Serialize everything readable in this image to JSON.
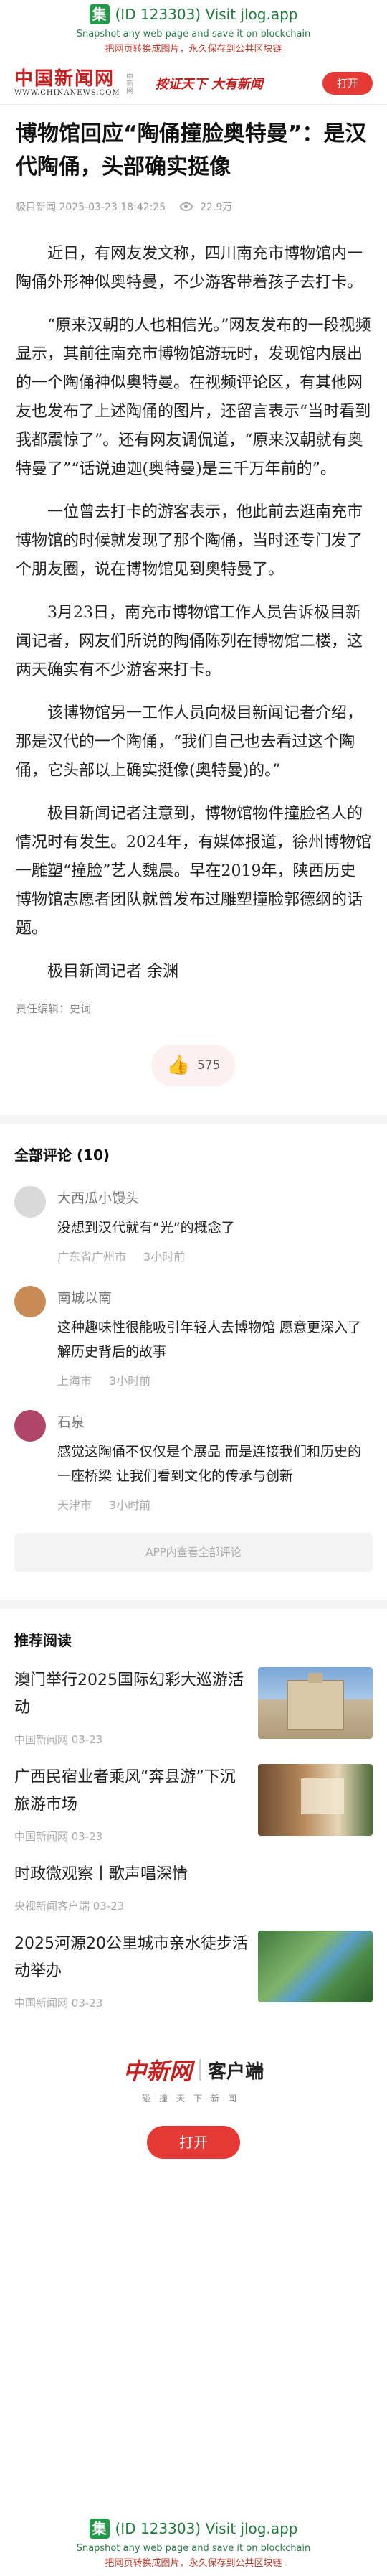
{
  "banner": {
    "logo_char": "集",
    "line1": "(ID 123303) Visit jlog.app",
    "line2": "Snapshot any web page and save it on blockchain",
    "line3": "把网页转换成图片，永久保存到公共区块链"
  },
  "header": {
    "brand_cn": "中国新闻网",
    "brand_en": "WWW.CHINANEWS.COM",
    "brand_sub": "中新网",
    "slogan": "按证天下 大有新闻",
    "open_label": "打开"
  },
  "article": {
    "title": "博物馆回应“陶俑撞脸奥特曼”：是汉代陶俑，头部确实挺像",
    "source": "极目新闻 2025-03-23 18:42:25",
    "views": "22.9万",
    "paragraphs": [
      "近日，有网友发文称，四川南充市博物馆内一陶俑外形神似奥特曼，不少游客带着孩子去打卡。",
      "“原来汉朝的人也相信光。”网友发布的一段视频显示，其前往南充市博物馆游玩时，发现馆内展出的一个陶俑神似奥特曼。在视频评论区，有其他网友也发布了上述陶俑的图片，还留言表示“当时看到我都震惊了”。还有网友调侃道，“原来汉朝就有奥特曼了”“话说迪迦(奥特曼)是三千万年前的”。",
      "一位曾去打卡的游客表示，他此前去逛南充市博物馆的时候就发现了那个陶俑，当时还专门发了个朋友圈，说在博物馆见到奥特曼了。",
      "3月23日，南充市博物馆工作人员告诉极目新闻记者，网友们所说的陶俑陈列在博物馆二楼，这两天确实有不少游客来打卡。",
      "该博物馆另一工作人员向极目新闻记者介绍，那是汉代的一个陶俑，“我们自己也去看过这个陶俑，它头部以上确实挺像(奥特曼)的。”",
      "极目新闻记者注意到，博物馆物件撞脸名人的情况时有发生。2024年，有媒体报道，徐州博物馆一雕塑“撞脸”艺人魏晨。早在2019年，陕西历史博物馆志愿者团队就曾发布过雕塑撞脸郭德纲的话题。",
      "极目新闻记者 余渊"
    ],
    "editor": "责任编辑：史词",
    "likes": "575"
  },
  "comments": {
    "title": "全部评论 (10)",
    "items": [
      {
        "name": "大西瓜小馒头",
        "text": "没想到汉代就有“光”的概念了",
        "location": "广东省广州市",
        "time": "3小时前",
        "color": "#d9d9d9"
      },
      {
        "name": "南城以南",
        "text": "这种趣味性很能吸引年轻人去博物馆 愿意更深入了解历史背后的故事",
        "location": "上海市",
        "time": "3小时前",
        "color": "#c98b55"
      },
      {
        "name": "石泉",
        "text": "感觉这陶俑不仅仅是个展品 而是连接我们和历史的一座桥梁 让我们看到文化的传承与创新",
        "location": "天津市",
        "time": "3小时前",
        "color": "#b0466a"
      }
    ],
    "more_label": "APP内查看全部评论"
  },
  "recommend": {
    "title": "推荐阅读",
    "items": [
      {
        "headline": "澳门举行2025国际幻彩大巡游活动",
        "source": "中国新闻网 03-23",
        "img": "church"
      },
      {
        "headline": "广西民宿业者乘风“奔县游”下沉旅游市场",
        "source": "中国新闻网 03-23",
        "img": "room"
      },
      {
        "headline": "时政微观察丨歌声唱深情",
        "source": "央视新闻客户端 03-23",
        "img": ""
      },
      {
        "headline": "2025河源20公里城市亲水徒步活动举办",
        "source": "中国新闻网 03-23",
        "img": "aerial"
      }
    ]
  },
  "footer": {
    "brand_cn": "中新网",
    "client": "客户端",
    "sub": "碰撞天下新闻",
    "open_label": "打开"
  }
}
